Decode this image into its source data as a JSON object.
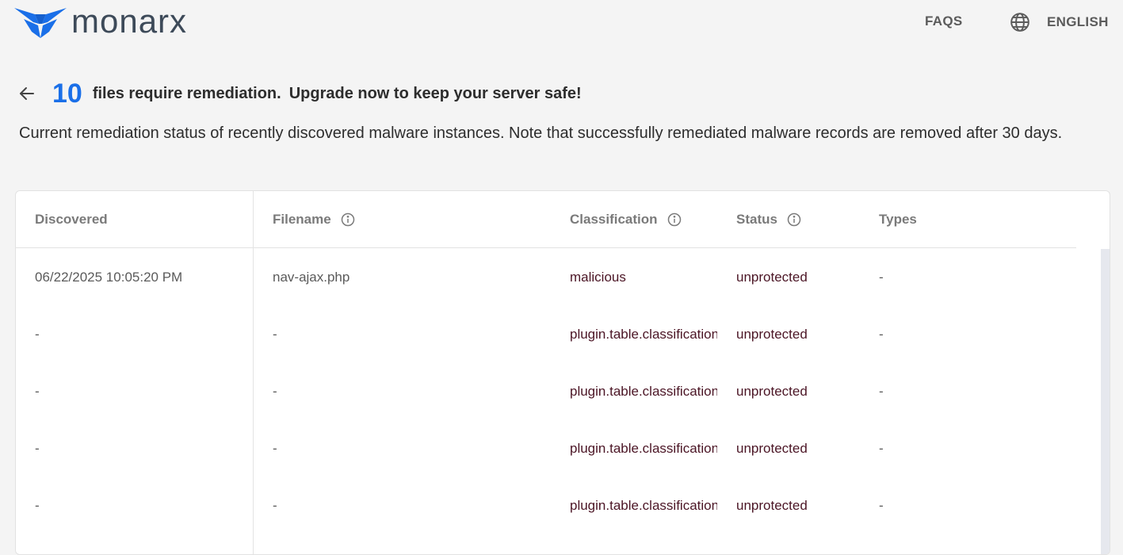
{
  "brand": {
    "name": "monarx",
    "logo_color": "#1a6fe8"
  },
  "nav": {
    "faqs": "FAQS",
    "language": "ENGLISH"
  },
  "headline": {
    "count": "10",
    "message": "files require remediation.",
    "cta": "Upgrade now to keep your server safe!"
  },
  "description": "Current remediation status of recently discovered malware instances. Note that successfully remediated malware records are removed after 30 days.",
  "table": {
    "columns": [
      "Discovered",
      "Filename",
      "Classification",
      "Status",
      "Types"
    ],
    "rows": [
      {
        "discovered": "06/22/2025 10:05:20 PM",
        "filename": "nav-ajax.php",
        "classification": "malicious",
        "status": "unprotected",
        "types": "-"
      },
      {
        "discovered": "-",
        "filename": "-",
        "classification": "plugin.table.classification",
        "status": "unprotected",
        "types": "-"
      },
      {
        "discovered": "-",
        "filename": "-",
        "classification": "plugin.table.classification",
        "status": "unprotected",
        "types": "-"
      },
      {
        "discovered": "-",
        "filename": "-",
        "classification": "plugin.table.classification",
        "status": "unprotected",
        "types": "-"
      },
      {
        "discovered": "-",
        "filename": "-",
        "classification": "plugin.table.classification",
        "status": "unprotected",
        "types": "-"
      }
    ]
  }
}
